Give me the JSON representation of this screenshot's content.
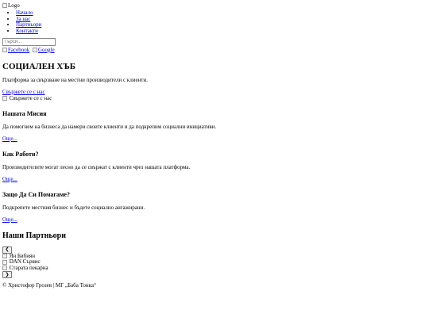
{
  "header": {
    "logo_alt": "Logo",
    "nav": [
      {
        "label": "Начало"
      },
      {
        "label": "За нас"
      },
      {
        "label": "Партньори"
      },
      {
        "label": "Контакти"
      }
    ],
    "search_placeholder": "Търси...",
    "social": [
      {
        "label": "Facebook",
        "icon": "facebook-icon"
      },
      {
        "label": "Google",
        "icon": "google-icon"
      }
    ]
  },
  "hero": {
    "title": "СОЦИАЛЕН ХЪБ",
    "subtitle": "Платформа за свързване на местни производители с клиенти.",
    "cta_label": "Свържете се с нас",
    "image_alt": "Свържете се с нас"
  },
  "cards": [
    {
      "title": "Нашата Мисия",
      "text": "Да помогнем на бизнеса да намери своите клиенти и да подкрепим социални инициативи.",
      "more": "Още..."
    },
    {
      "title": "Как Работи?",
      "text": "Производителите могат лесно да се свържат с клиенти чрез нашата платформа.",
      "more": "Още..."
    },
    {
      "title": "Защо Да Си Помагаме?",
      "text": "Подкрепете местния бизнес и бъдете социално ангажирани.",
      "more": "Още..."
    }
  ],
  "partners": {
    "title": "Наши Партньори",
    "prev_label": "❮",
    "next_label": "❯",
    "items": [
      {
        "alt": "Ян Бибиян"
      },
      {
        "alt": "DAN Сървис"
      },
      {
        "alt": "Старата пекарна"
      }
    ]
  },
  "footer": {
    "text": "© Христофор Грозев | МГ „Баба Тонка“"
  }
}
